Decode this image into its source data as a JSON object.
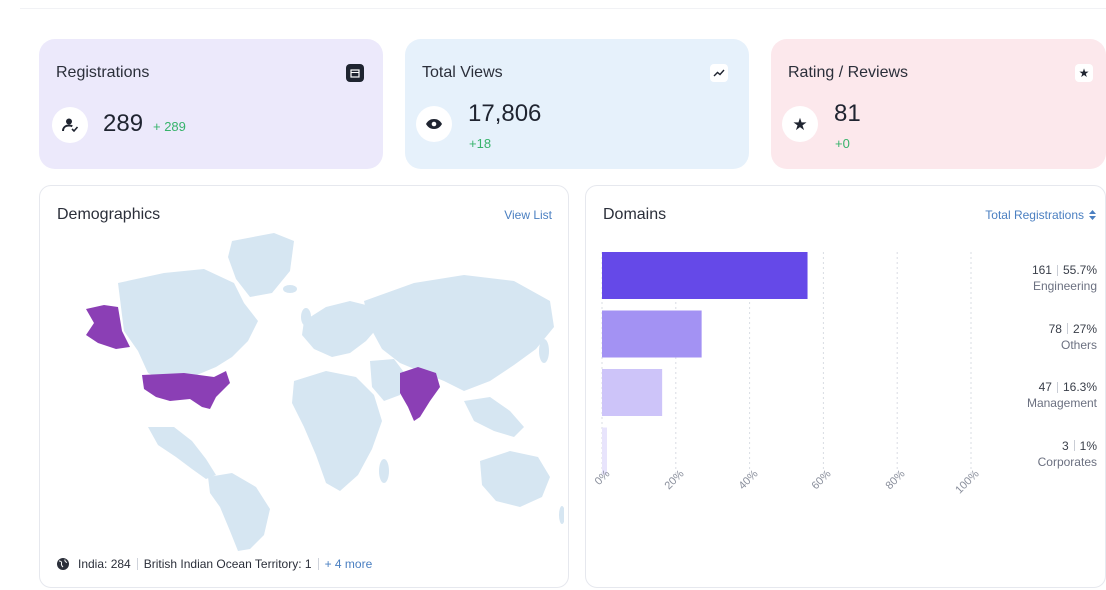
{
  "stats": [
    {
      "title": "Registrations",
      "value": "289",
      "delta": "+ 289",
      "icon": "user-check-icon",
      "corner_icon": "calendar-icon",
      "bg": "#ece9fb"
    },
    {
      "title": "Total Views",
      "value": "17,806",
      "delta": "+18",
      "icon": "eye-icon",
      "corner_icon": "trend-up-icon",
      "bg": "#e6f1fb"
    },
    {
      "title": "Rating / Reviews",
      "value": "81",
      "delta": "+0",
      "icon": "star-icon",
      "corner_icon": "star-outline-icon",
      "bg": "#fce8ec"
    }
  ],
  "demographics": {
    "title": "Demographics",
    "view_list": "View List",
    "legend": {
      "icon": "globe-icon",
      "item1": "India: 284",
      "item2": "British Indian Ocean Territory: 1",
      "more": "+ 4 more"
    },
    "highlight_color": "#8b3fb5",
    "land_color": "#d6e6f2"
  },
  "domains": {
    "title": "Domains",
    "sort_label": "Total Registrations"
  },
  "chart_data": {
    "type": "bar",
    "orientation": "horizontal",
    "categories": [
      "Engineering",
      "Others",
      "Management",
      "Corporates"
    ],
    "values": [
      161,
      78,
      47,
      3
    ],
    "percentages": [
      "55.7%",
      "27%",
      "16.3%",
      "1%"
    ],
    "percent_values": [
      55.7,
      27,
      16.3,
      1
    ],
    "colors": [
      "#6549e8",
      "#a392f3",
      "#cdc4f9",
      "#e8e4fc"
    ],
    "xlim": [
      0,
      100
    ],
    "x_ticks": [
      "0%",
      "20%",
      "40%",
      "60%",
      "80%",
      "100%"
    ],
    "grid": true
  }
}
